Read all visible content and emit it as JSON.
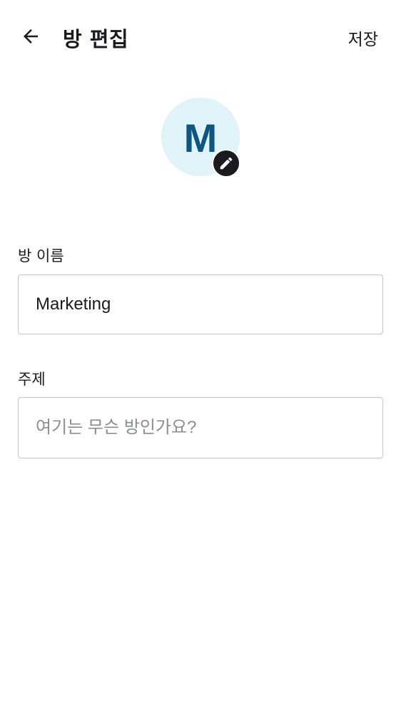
{
  "topbar": {
    "back_icon": "arrow-left-icon",
    "title": "방 편집",
    "save_label": "저장"
  },
  "avatar": {
    "letter": "M",
    "background": "#e0f3f8",
    "letter_color": "#0b5685",
    "edit_icon": "pencil-icon"
  },
  "fields": {
    "room_name": {
      "label": "방 이름",
      "value": "Marketing"
    },
    "topic": {
      "label": "주제",
      "value": "",
      "placeholder": "여기는 무슨 방인가요?"
    }
  }
}
